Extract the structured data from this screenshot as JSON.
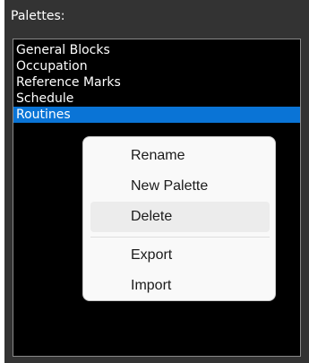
{
  "panel": {
    "title": "Palettes:"
  },
  "palettes": [
    {
      "label": "General Blocks",
      "selected": false
    },
    {
      "label": "Occupation",
      "selected": false
    },
    {
      "label": "Reference Marks",
      "selected": false
    },
    {
      "label": "Schedule",
      "selected": false
    },
    {
      "label": "Routines",
      "selected": true
    }
  ],
  "context_menu": {
    "items": [
      {
        "label": "Rename"
      },
      {
        "label": "New Palette"
      },
      {
        "label": "Delete",
        "hovered": true
      },
      {
        "label": "Export"
      },
      {
        "label": "Import"
      }
    ]
  },
  "colors": {
    "panel_bg": "#333333",
    "list_bg": "#000000",
    "selection": "#0a74d6",
    "menu_bg": "#f9f9f9",
    "menu_hover": "#ececec"
  }
}
